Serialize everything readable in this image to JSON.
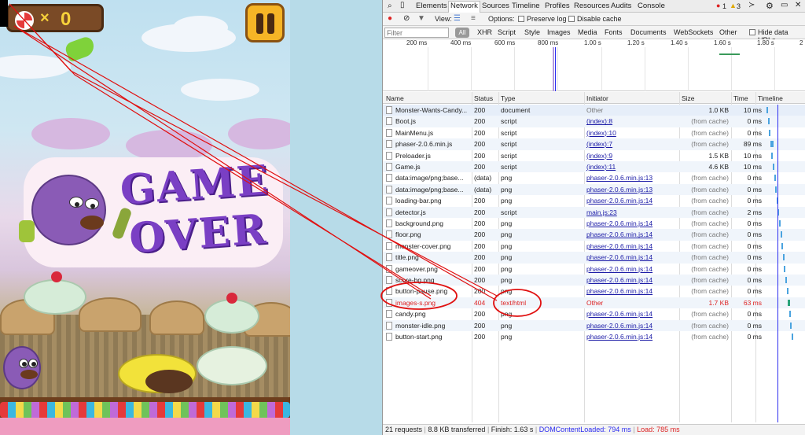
{
  "game": {
    "score_symbol": "×",
    "score_value": "0",
    "gameover_line1": "GAME",
    "gameover_line2": "OVER"
  },
  "devtools": {
    "tabs": [
      "Elements",
      "Network",
      "Sources",
      "Timeline",
      "Profiles",
      "Resources",
      "Audits",
      "Console"
    ],
    "active_tab": "Network",
    "badges": {
      "errors": "1",
      "warnings": "3"
    },
    "toolbar": {
      "view_label": "View:",
      "options_label": "Options:",
      "preserve_log": "Preserve log",
      "disable_cache": "Disable cache"
    },
    "filter": {
      "placeholder": "Filter",
      "all": "All",
      "types": [
        "XHR",
        "Script",
        "Style",
        "Images",
        "Media",
        "Fonts",
        "Documents",
        "WebSockets",
        "Other"
      ],
      "hide_data_urls": "Hide data URLs"
    },
    "overview_ticks": [
      "200 ms",
      "400 ms",
      "600 ms",
      "800 ms",
      "1.00 s",
      "1.20 s",
      "1.40 s",
      "1.60 s",
      "1.80 s",
      "2"
    ],
    "columns": [
      "Name",
      "Status",
      "Type",
      "Initiator",
      "Size",
      "Time",
      "Timeline"
    ],
    "rows": [
      {
        "name": "Monster-Wants-Candy...",
        "status": "200",
        "type": "document",
        "initiator": "Other",
        "size": "1.0 KB",
        "time": "10 ms"
      },
      {
        "name": "Boot.js",
        "status": "200",
        "type": "script",
        "initiator": "(index):8",
        "size": "(from cache)",
        "time": "0 ms"
      },
      {
        "name": "MainMenu.js",
        "status": "200",
        "type": "script",
        "initiator": "(index):10",
        "size": "(from cache)",
        "time": "0 ms"
      },
      {
        "name": "phaser-2.0.6.min.js",
        "status": "200",
        "type": "script",
        "initiator": "(index):7",
        "size": "(from cache)",
        "time": "89 ms"
      },
      {
        "name": "Preloader.js",
        "status": "200",
        "type": "script",
        "initiator": "(index):9",
        "size": "1.5 KB",
        "time": "10 ms"
      },
      {
        "name": "Game.js",
        "status": "200",
        "type": "script",
        "initiator": "(index):11",
        "size": "4.6 KB",
        "time": "10 ms"
      },
      {
        "name": "data:image/png;base...",
        "status": "(data)",
        "type": "png",
        "initiator": "phaser-2.0.6.min.js:13",
        "size": "(from cache)",
        "time": "0 ms"
      },
      {
        "name": "data:image/png;base...",
        "status": "(data)",
        "type": "png",
        "initiator": "phaser-2.0.6.min.js:13",
        "size": "(from cache)",
        "time": "0 ms"
      },
      {
        "name": "loading-bar.png",
        "status": "200",
        "type": "png",
        "initiator": "phaser-2.0.6.min.js:14",
        "size": "(from cache)",
        "time": "0 ms"
      },
      {
        "name": "detector.js",
        "status": "200",
        "type": "script",
        "initiator": "main.js:23",
        "size": "(from cache)",
        "time": "2 ms"
      },
      {
        "name": "background.png",
        "status": "200",
        "type": "png",
        "initiator": "phaser-2.0.6.min.js:14",
        "size": "(from cache)",
        "time": "0 ms"
      },
      {
        "name": "floor.png",
        "status": "200",
        "type": "png",
        "initiator": "phaser-2.0.6.min.js:14",
        "size": "(from cache)",
        "time": "0 ms"
      },
      {
        "name": "monster-cover.png",
        "status": "200",
        "type": "png",
        "initiator": "phaser-2.0.6.min.js:14",
        "size": "(from cache)",
        "time": "0 ms"
      },
      {
        "name": "title.png",
        "status": "200",
        "type": "png",
        "initiator": "phaser-2.0.6.min.js:14",
        "size": "(from cache)",
        "time": "0 ms"
      },
      {
        "name": "gameover.png",
        "status": "200",
        "type": "png",
        "initiator": "phaser-2.0.6.min.js:14",
        "size": "(from cache)",
        "time": "0 ms"
      },
      {
        "name": "score-bg.png",
        "status": "200",
        "type": "png",
        "initiator": "phaser-2.0.6.min.js:14",
        "size": "(from cache)",
        "time": "0 ms"
      },
      {
        "name": "button-pause.png",
        "status": "200",
        "type": "png",
        "initiator": "phaser-2.0.6.min.js:14",
        "size": "(from cache)",
        "time": "0 ms"
      },
      {
        "name": "images-s.png",
        "status": "404",
        "type": "text/html",
        "initiator": "Other",
        "size": "1.7 KB",
        "time": "63 ms",
        "error": true
      },
      {
        "name": "candy.png",
        "status": "200",
        "type": "png",
        "initiator": "phaser-2.0.6.min.js:14",
        "size": "(from cache)",
        "time": "0 ms"
      },
      {
        "name": "monster-idle.png",
        "status": "200",
        "type": "png",
        "initiator": "phaser-2.0.6.min.js:14",
        "size": "(from cache)",
        "time": "0 ms"
      },
      {
        "name": "button-start.png",
        "status": "200",
        "type": "png",
        "initiator": "phaser-2.0.6.min.js:14",
        "size": "(from cache)",
        "time": "0 ms"
      }
    ],
    "status_bar": {
      "requests": "21 requests",
      "transferred": "8.8 KB transferred",
      "finish": "Finish: 1.63 s",
      "dcl": "DOMContentLoaded: 794 ms",
      "load": "Load: 785 ms"
    },
    "colors": {
      "link": "#1a1aa6",
      "error": "#dd2222",
      "dcl": "#2d2df0",
      "load": "#dd2222",
      "annotation": "#e01010"
    }
  }
}
